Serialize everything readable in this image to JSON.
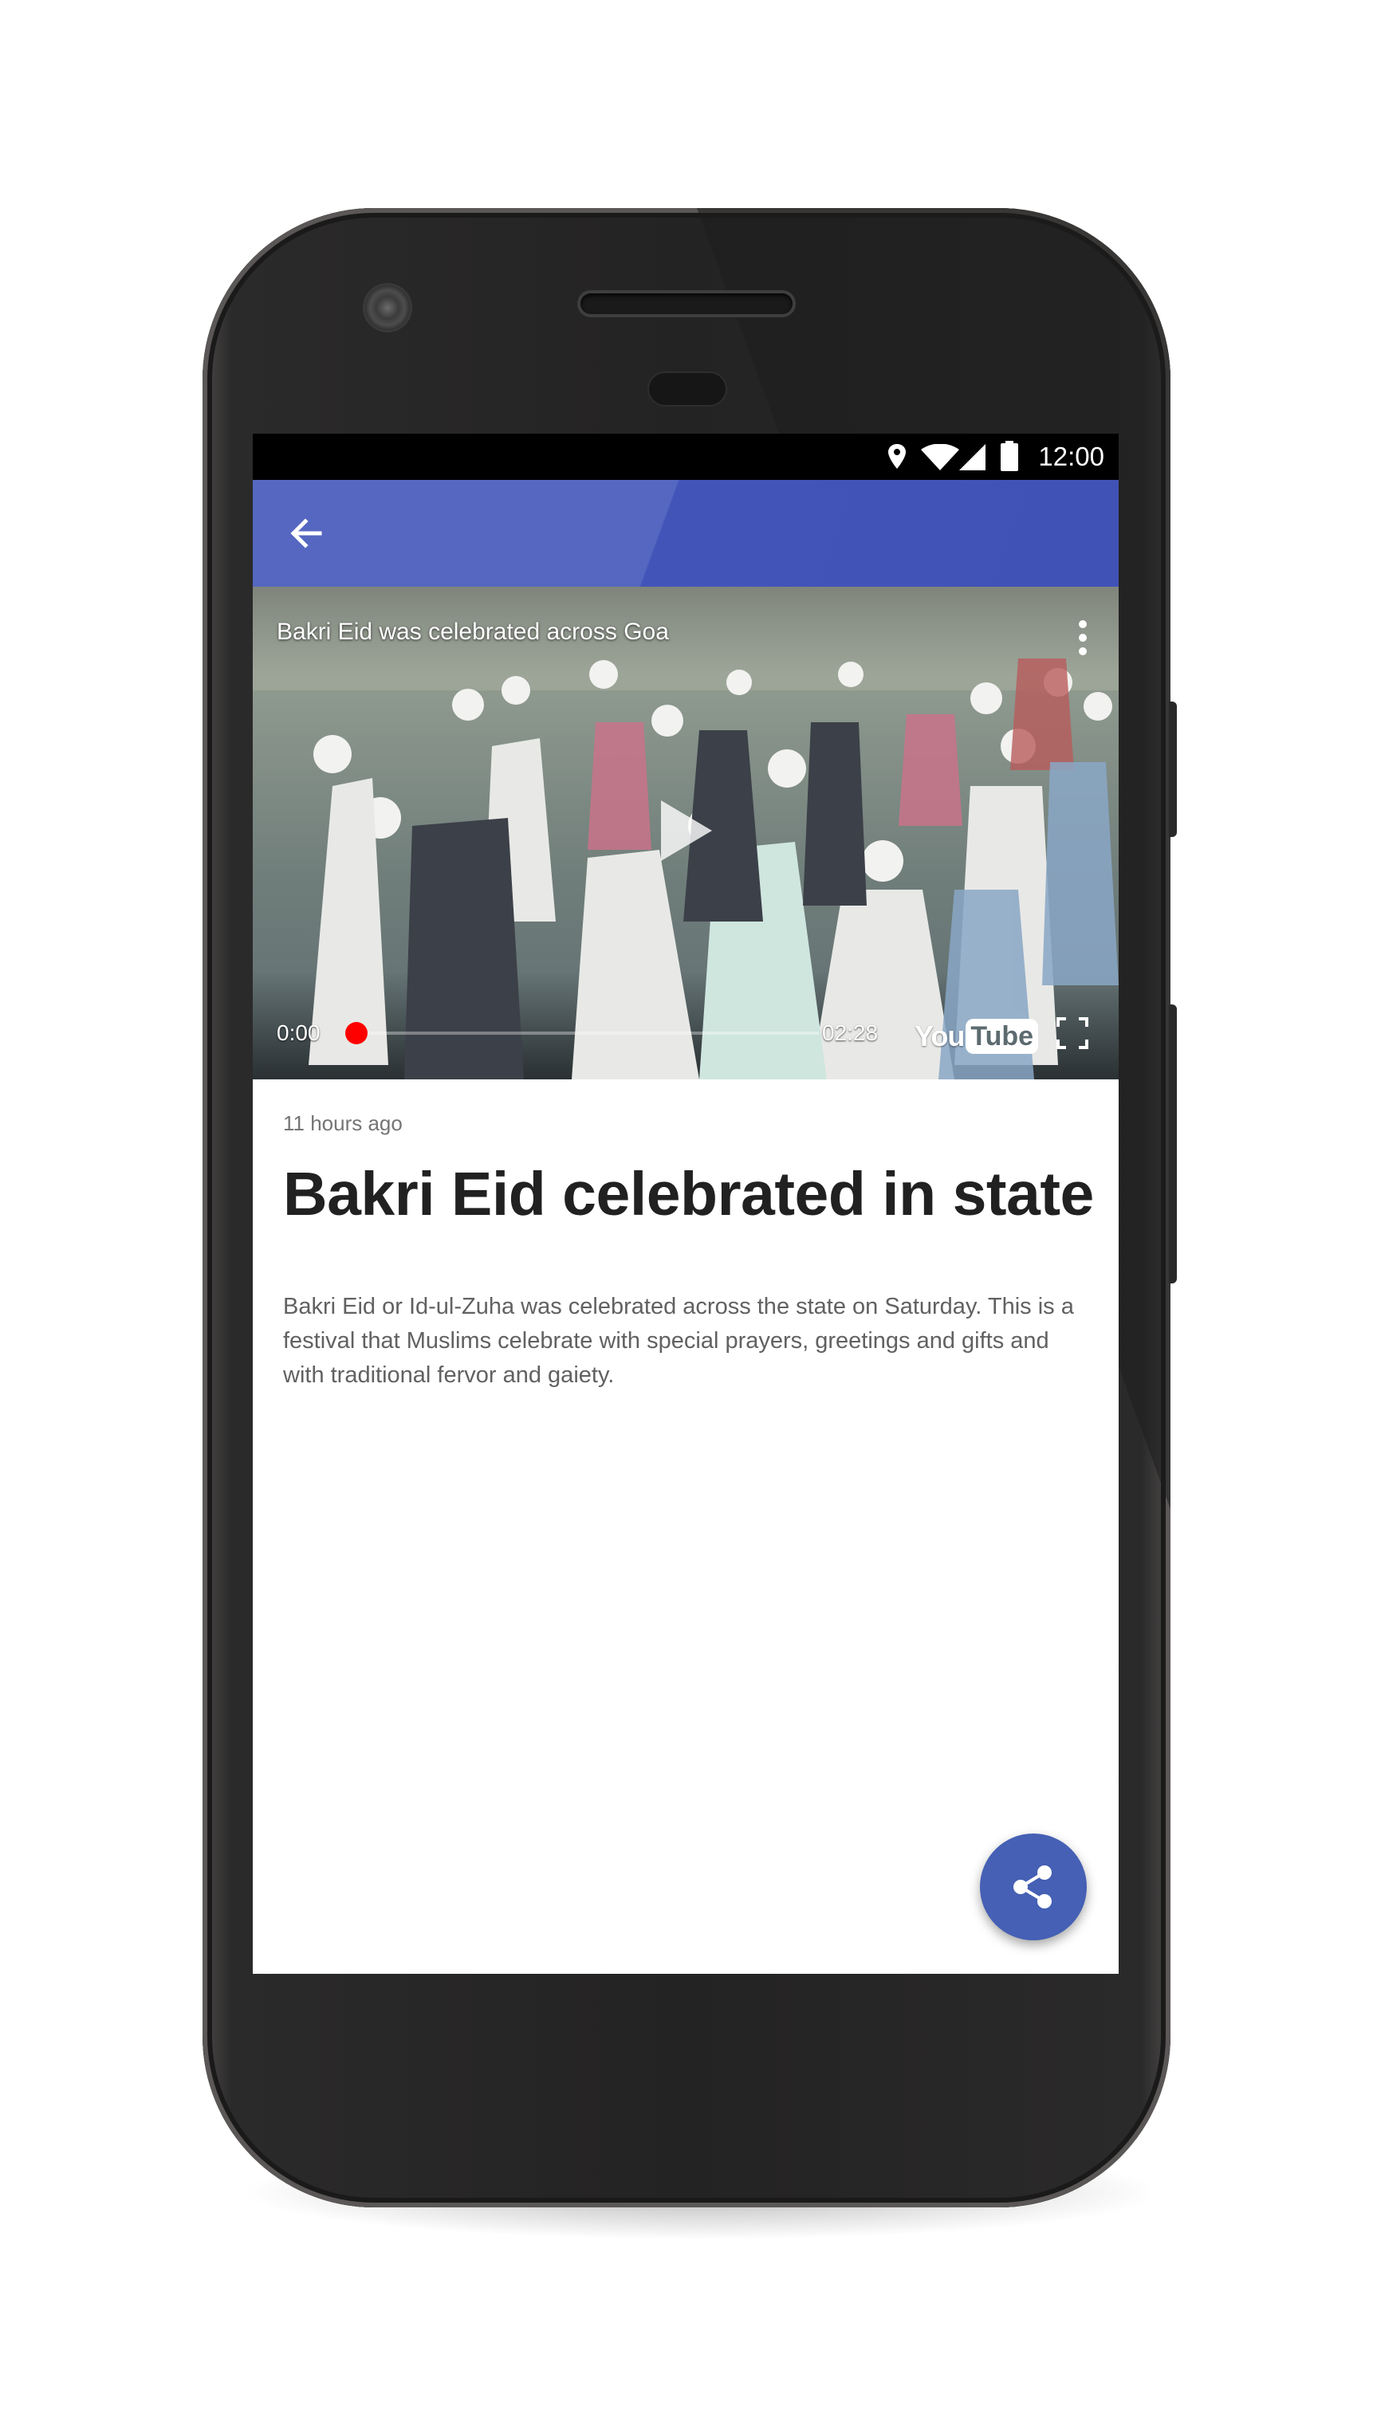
{
  "status_bar": {
    "time": "12:00",
    "icons": [
      "location-icon",
      "wifi-icon",
      "cellular-signal-icon",
      "battery-icon"
    ]
  },
  "app_bar": {
    "back_icon": "arrow-back-icon",
    "color": "#4152b6"
  },
  "video": {
    "title": "Bakri Eid was celebrated across Goa",
    "current_time": "0:00",
    "duration": "02:28",
    "progress": 0,
    "logo": {
      "you": "You",
      "tube": "Tube"
    },
    "accent": "#ff0000"
  },
  "article": {
    "timestamp": "11 hours ago",
    "headline": "Bakri Eid celebrated in state",
    "body": "Bakri Eid or Id-ul-Zuha was celebrated across the state on Saturday. This is a festival that Muslims celebrate with special prayers, greetings and gifts and with traditional fervor and gaiety."
  },
  "fab": {
    "icon": "share-icon",
    "color": "#4560b4"
  }
}
